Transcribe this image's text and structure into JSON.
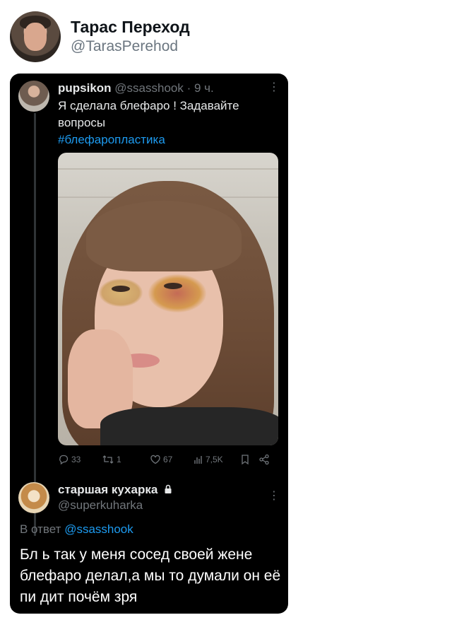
{
  "outer": {
    "name": "Тарас Переход",
    "handle": "@TarasPerehod"
  },
  "tweet1": {
    "name": "pupsikon",
    "meta": "@ssasshook · 9 ч.",
    "text": "Я сделала блефаро ! Задавайте вопросы",
    "hashtag": "#блефаропластика",
    "actions": {
      "replies": "33",
      "retweets": "1",
      "likes": "67",
      "views": "7,5K"
    }
  },
  "tweet2": {
    "name": "старшая кухарка",
    "handle": "@superkuharka",
    "reply_prefix": "В ответ",
    "reply_mention": "@ssasshook",
    "text": "Бл    ь так у меня сосед своей жене блефаро делал,а мы то думали он её пи    дит почём зря"
  },
  "colors": {
    "accent": "#1d9bf0",
    "card_bg": "#000000",
    "muted": "#71767b"
  },
  "icons": [
    "reply-icon",
    "retweet-icon",
    "like-icon",
    "views-icon",
    "bookmark-icon",
    "share-icon",
    "more-icon",
    "lock-icon"
  ]
}
